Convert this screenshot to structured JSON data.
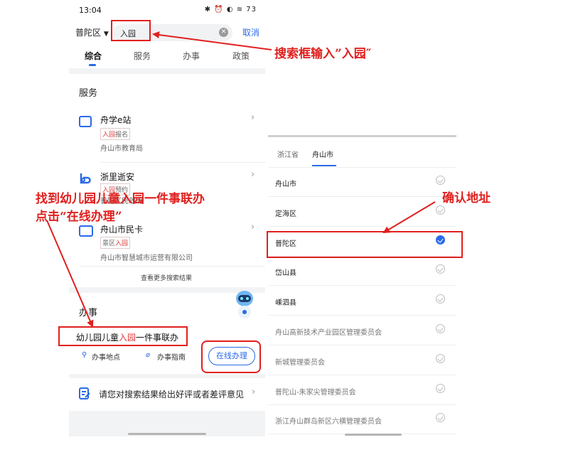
{
  "left_phone": {
    "status_time": "13:04",
    "status_icons": "✱ ⏰ ◐ ≋ 73",
    "region": "普陀区",
    "search_value": "入园",
    "cancel": "取消",
    "tabs": [
      "综合",
      "服务",
      "办事",
      "政策"
    ],
    "services_title": "服务",
    "services": [
      {
        "title": "舟学e站",
        "tag_hl": "入园",
        "tag_rest": "报名",
        "tag_hl_first": true,
        "sub": "舟山市教育局"
      },
      {
        "title": "浙里逝安",
        "tag_hl": "入园",
        "tag_rest": "预约",
        "tag_hl_first": true,
        "sub": "普陀区民政局"
      },
      {
        "title": "舟山市民卡",
        "tag_hl": "入园",
        "tag_rest": "景区",
        "tag_hl_first": false,
        "sub": "舟山市智慧城市运营有限公司"
      }
    ],
    "more_results": "查看更多搜索结果",
    "affairs_title": "办事",
    "affair": {
      "pre": "幼儿园儿童",
      "hl": "入园",
      "post": "一件事联办"
    },
    "affair_links": [
      "办事地点",
      "办事指南"
    ],
    "online_button": "在线办理",
    "feedback": "请您对搜索结果给出好评或者差评意见"
  },
  "right_phone": {
    "tabs": [
      "浙江省",
      "舟山市"
    ],
    "active_tab": 1,
    "rows": [
      {
        "label": "舟山市",
        "checked": false,
        "gray": false
      },
      {
        "label": "定海区",
        "checked": false,
        "gray": false
      },
      {
        "label": "普陀区",
        "checked": true,
        "gray": false
      },
      {
        "label": "岱山县",
        "checked": false,
        "gray": false
      },
      {
        "label": "嵊泗县",
        "checked": false,
        "gray": false
      },
      {
        "label": "舟山高新技术产业园区管理委员会",
        "checked": false,
        "gray": true
      },
      {
        "label": "新城管理委员会",
        "checked": false,
        "gray": true
      },
      {
        "label": "普陀山-朱家尖管理委员会",
        "checked": false,
        "gray": true
      },
      {
        "label": "浙江舟山群岛新区六横管理委员会",
        "checked": false,
        "gray": true
      }
    ]
  },
  "annotations": {
    "search_note": "搜索框输入”入园″",
    "find_note_line1": "找到幼儿园儿童入园一件事联办",
    "find_note_line2": "点击“在线办理”",
    "confirm_note": "确认地址"
  },
  "colors": {
    "accent": "#2a6ae8",
    "annotation": "#e0201e",
    "highlight": "#e23b3b"
  }
}
